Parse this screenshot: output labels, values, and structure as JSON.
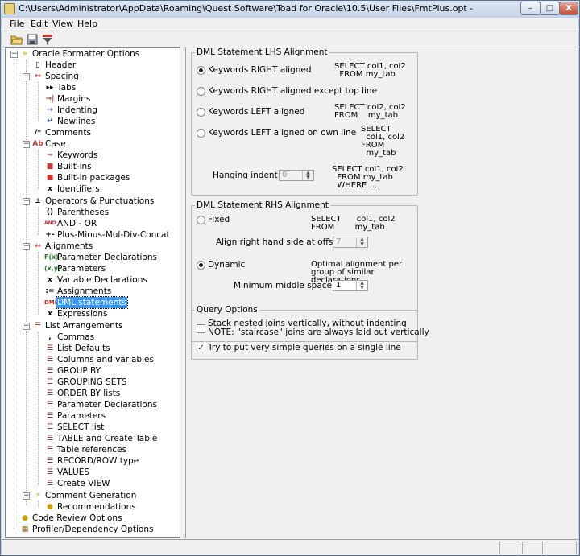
{
  "window": {
    "title": "C:\\Users\\Administrator\\AppData\\Roaming\\Quest Software\\Toad for Oracle\\10.5\\User Files\\FmtPlus.opt -",
    "controls": {
      "minimize": "–",
      "maximize": "□",
      "close": "X"
    }
  },
  "menu": [
    "File",
    "Edit",
    "View",
    "Help"
  ],
  "toolbar": {
    "buttons": [
      "open-icon",
      "save-icon",
      "filter-icon"
    ]
  },
  "tree": {
    "root": "Oracle Formatter Options",
    "items": {
      "header": "Header",
      "spacing": "Spacing",
      "tabs": "Tabs",
      "margins": "Margins",
      "indenting": "Indenting",
      "newlines": "Newlines",
      "comments": "Comments",
      "case": "Case",
      "keywords": "Keywords",
      "builtins": "Built-ins",
      "builtin_packages": "Built-in packages",
      "identifiers": "Identifiers",
      "operators": "Operators & Punctuations",
      "parentheses": "Parentheses",
      "and_or": "AND - OR",
      "plus_minus": "Plus-Minus-Mul-Div-Concat",
      "alignments": "Alignments",
      "param_decl": "Parameter Declarations",
      "parameters": "Parameters",
      "var_decl": "Variable Declarations",
      "assignments": "Assignments",
      "dml": "DML statements",
      "expressions": "Expressions",
      "list_arr": "List Arrangements",
      "commas": "Commas",
      "list_defaults": "List Defaults",
      "columns_vars": "Columns and variables",
      "group_by": "GROUP BY",
      "grouping_sets": "GROUPING SETS",
      "order_by": "ORDER BY lists",
      "la_param_decl": "Parameter Declarations",
      "la_parameters": "Parameters",
      "select_list": "SELECT list",
      "table_create": "TABLE and Create Table",
      "table_refs": "Table references",
      "record_row": "RECORD/ROW type",
      "values": "VALUES",
      "create_view": "Create VIEW",
      "comment_gen": "Comment Generation",
      "recommendations": "Recommendations",
      "code_review": "Code Review Options",
      "profiler": "Profiler/Dependency Options"
    },
    "selected": "DML statements"
  },
  "lhs": {
    "title": "DML Statement LHS Alignment",
    "options": [
      {
        "label": "Keywords RIGHT aligned",
        "sample": "SELECT col1, col2\n  FROM my_tab",
        "selected": true
      },
      {
        "label": "Keywords RIGHT aligned except top line",
        "sample": "",
        "selected": false
      },
      {
        "label": "Keywords LEFT aligned",
        "sample": "SELECT col2, col2\nFROM    my_tab",
        "selected": false
      },
      {
        "label": "Keywords LEFT aligned on own line",
        "sample": "SELECT\n  col1, col2\nFROM\n  my_tab",
        "selected": false
      }
    ],
    "hanging": {
      "label": "Hanging indent:",
      "value": "0",
      "sample": "SELECT col1, col2\n  FROM my_tab\n  WHERE ..."
    }
  },
  "rhs": {
    "title": "DML Statement RHS Alignment",
    "fixed": {
      "label": "Fixed",
      "sample": "SELECT      col1, col2\nFROM        my_tab",
      "selected": false
    },
    "offset": {
      "label": "Align right hand side at offset:",
      "value": "7"
    },
    "dynamic": {
      "label": "Dynamic",
      "sample": "Optimal alignment per\ngroup of similar\ndeclarations",
      "selected": true
    },
    "min_space": {
      "label": "Minimum middle space:",
      "value": "1"
    }
  },
  "query": {
    "title": "Query Options",
    "stack": {
      "label": "Stack nested joins vertically, without indenting",
      "note": "NOTE: \"staircase\" joins are always laid out vertically",
      "checked": false
    },
    "simple": {
      "label": "Try to put very simple queries on a single line",
      "checked": true
    }
  }
}
